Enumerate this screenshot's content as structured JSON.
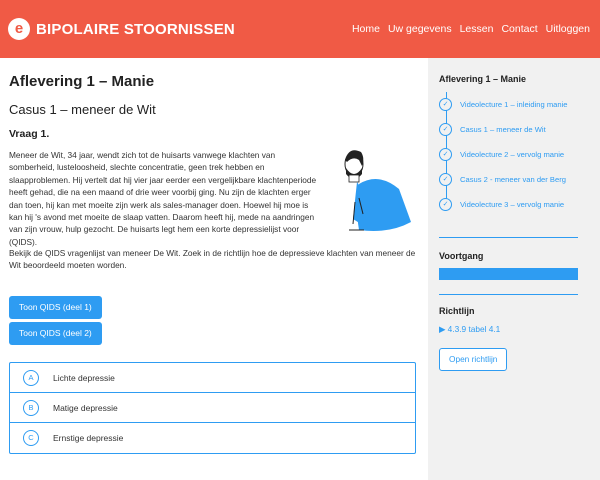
{
  "header": {
    "logo_letter": "e",
    "title": "BIPOLAIRE STOORNISSEN",
    "nav": [
      {
        "label": "Home"
      },
      {
        "label": "Uw gegevens"
      },
      {
        "label": "Lessen"
      },
      {
        "label": "Contact"
      },
      {
        "label": "Uitloggen"
      }
    ]
  },
  "main": {
    "episode_title": "Aflevering 1 – Manie",
    "case_title": "Casus 1 – meneer de Wit",
    "question": "Vraag 1.",
    "paragraph1": "Meneer de Wit, 34 jaar, wendt zich tot de huisarts vanwege klachten van somberheid, lusteloosheid, slechte concentratie, geen trek hebben en slaapproblemen. Hij vertelt dat hij vier jaar eerder een vergelijkbare klachtenperiode heeft gehad, die na een maand of drie weer voorbij ging. Nu zijn de klachten erger dan toen, hij kan met moeite zijn werk als sales-manager doen. Hoewel hij moe is kan hij 's avond met moeite de slaap vatten. Daarom heeft hij, mede na aandringen van zijn vrouw, hulp gezocht. De huisarts legt hem een korte depressielijst voor (QIDS).",
    "paragraph2": "Bekijk de QIDS vragenlijst van meneer De Wit. Zoek in de richtlijn hoe de depressieve klachten van meneer de Wit beoordeeld moeten worden.",
    "buttons": {
      "qids1": "Toon QIDS (deel 1)",
      "qids2": "Toon QIDS (deel 2)"
    },
    "options": [
      {
        "letter": "A",
        "label": "Lichte depressie"
      },
      {
        "letter": "B",
        "label": "Matige depressie"
      },
      {
        "letter": "C",
        "label": "Ernstige depressie"
      }
    ]
  },
  "sidebar": {
    "title": "Aflevering 1 – Manie",
    "episodes": [
      {
        "label": "Videolecture 1 – inleiding manie"
      },
      {
        "label": "Casus 1 – meneer de Wit"
      },
      {
        "label": "Videolecture 2 – vervolg manie"
      },
      {
        "label": "Casus 2 - meneer van der Berg"
      },
      {
        "label": "Videolecture 3 – vervolg manie"
      }
    ],
    "check_icon": "✓",
    "progress_title": "Voortgang",
    "progress_value": 1.0,
    "guideline_title": "Richtlijn",
    "guideline_link": "▶ 4.3.9 tabel 4.1",
    "open_button": "Open richtlijn"
  },
  "colors": {
    "header_bg": "#f05a45",
    "accent": "#2e9cf2",
    "sidebar_bg": "#f1f1f1"
  }
}
